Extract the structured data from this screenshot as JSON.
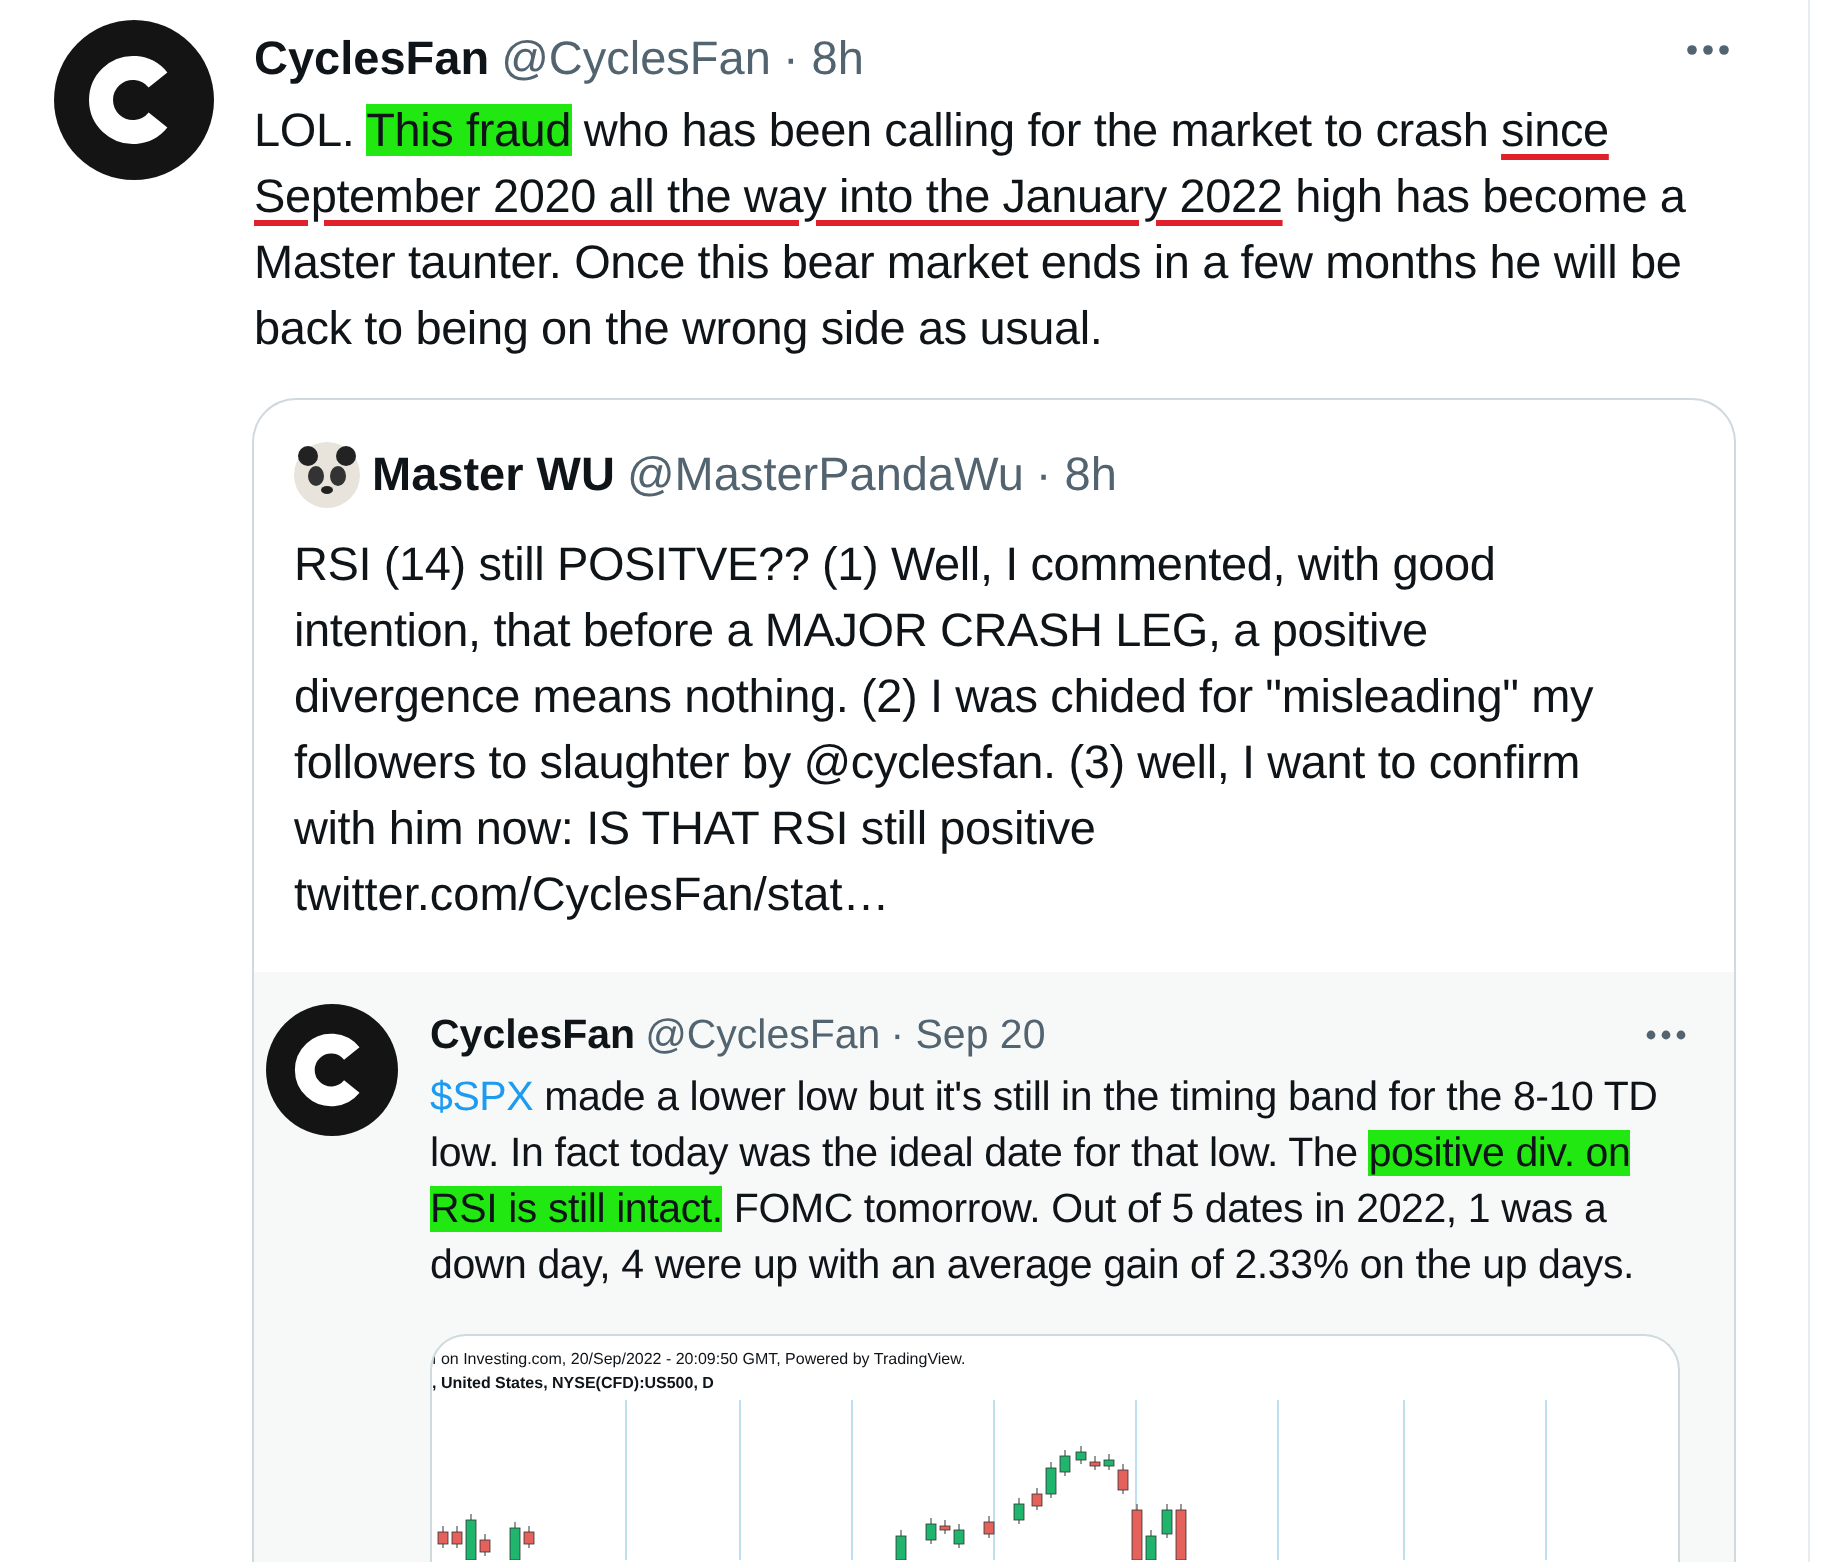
{
  "tweet": {
    "author": "CyclesFan",
    "handle": "@CyclesFan",
    "time": "· 8h",
    "text": [
      {
        "text": "LOL. ",
        "kind": "plain"
      },
      {
        "text": "This fraud",
        "kind": "highlight"
      },
      {
        "text": " who has been calling for the market to crash ",
        "kind": "plain"
      },
      {
        "text": "since September 2020 all the way into the January 2022",
        "kind": "underline"
      },
      {
        "text": " high has become a Master taunter. Once this bear market ends in a few months he will be back to being on the wrong side as usual.",
        "kind": "plain"
      }
    ],
    "quote": {
      "author": "Master WU",
      "handle": "@MasterPandaWu",
      "time": "· 8h",
      "text": "RSI (14) still POSITVE?? (1) Well, I commented, with good intention, that before a MAJOR CRASH LEG, a positive divergence means nothing. (2) I was chided for \"misleading\" my followers to slaughter by @cyclesfan. (3) well, I want to confirm with him now: IS THAT RSI still positive",
      "link": "twitter.com/CyclesFan/stat…",
      "quote": {
        "author": "CyclesFan",
        "handle": "@CyclesFan",
        "time": "· Sep 20",
        "text": [
          {
            "text": "$SPX",
            "kind": "link"
          },
          {
            "text": " made a lower low but it's still in the timing band for the 8-10 TD low. In fact today was the ideal date for that low. The ",
            "kind": "plain"
          },
          {
            "text": "positive div. on RSI is still intact.",
            "kind": "highlight"
          },
          {
            "text": " FOMC tomorrow. Out of 5 dates in 2022, 1 was a down day, 4 were up with an average gain of 2.33% on the up days.",
            "kind": "plain"
          }
        ],
        "chart_image": {
          "caption": "ı on Investing.com, 20/Sep/2022 - 20:09:50 GMT, Powered by TradingView.",
          "symbol": ", United States, NYSE(CFD):US500, D"
        }
      }
    }
  }
}
